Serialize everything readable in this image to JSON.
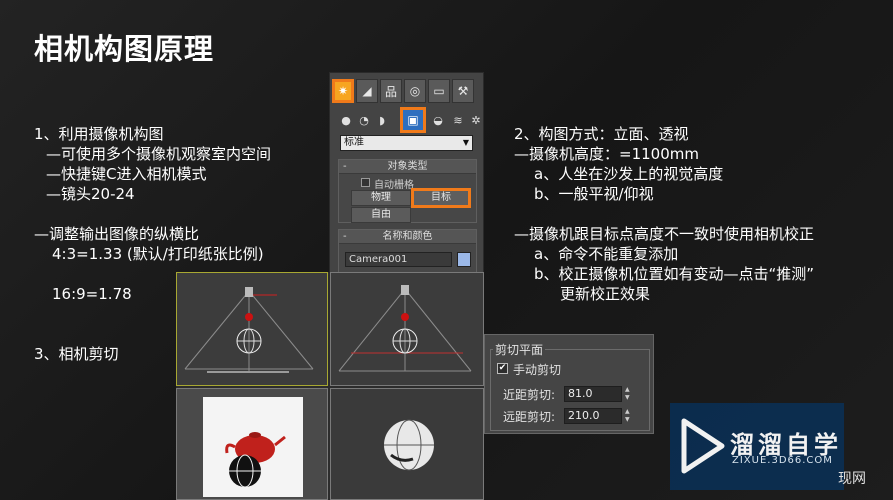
{
  "title": "相机构图原理",
  "left_notes": [
    "1、利用摄像机构图",
    "—可使用多个摄像机观察室内空间",
    "—快捷键C进入相机模式",
    "—镜头20-24",
    "",
    "—调整输出图像的纵横比",
    "4:3=1.33 (默认/打印纸张比例)",
    "",
    "16:9=1.78",
    "",
    "",
    "3、相机剪切"
  ],
  "right_notes": [
    "2、构图方式：立面、透视",
    "—摄像机高度：=1100mm",
    "a、人坐在沙发上的视觉高度",
    "b、一般平视/仰视",
    "",
    "—摄像机跟目标点高度不一致时使用相机校正",
    "a、命令不能重复添加",
    "b、校正摄像机位置如有变动—点击“推测”",
    "更新校正效果"
  ],
  "command_panel": {
    "tabs": [
      {
        "icon": "create-icon",
        "glyph": "✷",
        "active": true
      },
      {
        "icon": "modify-icon",
        "glyph": "◢",
        "active": false
      },
      {
        "icon": "hierarchy-icon",
        "glyph": "品",
        "active": false
      },
      {
        "icon": "motion-icon",
        "glyph": "◎",
        "active": false
      },
      {
        "icon": "display-icon",
        "glyph": "▭",
        "active": false
      },
      {
        "icon": "utilities-icon",
        "glyph": "⚒",
        "active": false
      }
    ],
    "sub_icons": [
      {
        "icon": "geometry-icon",
        "glyph": "●"
      },
      {
        "icon": "shapes-icon",
        "glyph": "◔"
      },
      {
        "icon": "lights-icon",
        "glyph": "◗"
      },
      {
        "icon": "cameras-icon",
        "glyph": "▣"
      },
      {
        "icon": "helpers-icon",
        "glyph": "◒"
      },
      {
        "icon": "spacewarps-icon",
        "glyph": "≋"
      },
      {
        "icon": "systems-icon",
        "glyph": "✲"
      }
    ],
    "dropdown_value": "标准",
    "object_type": {
      "header": "对象类型",
      "auto_grid_label": "自动栅格",
      "buttons": [
        "物理",
        "目标",
        "自由"
      ]
    },
    "name_color": {
      "header": "名称和颜色",
      "name_value": "Camera001",
      "color": "#9bb8e8"
    }
  },
  "clipping": {
    "title": "剪切平面",
    "manual_label": "手动剪切",
    "manual_checked": true,
    "near_label": "近距剪切:",
    "near_value": "81.0",
    "far_label": "远距剪切:",
    "far_value": "210.0"
  },
  "watermark": {
    "name": "溜溜自学",
    "url": "ZIXUE.3D66.COM",
    "tail": "现网"
  }
}
